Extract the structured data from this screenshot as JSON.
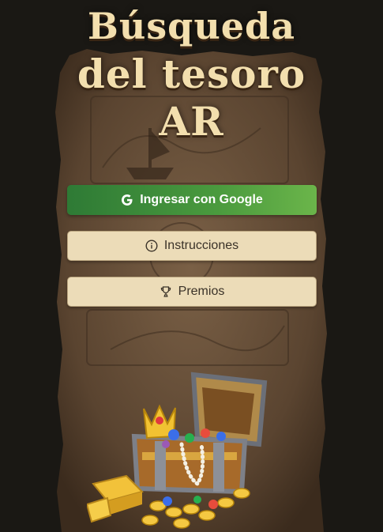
{
  "app": {
    "title_line1": "Búsqueda",
    "title_line2": "del tesoro",
    "title_line3": "AR"
  },
  "buttons": {
    "google_label": "Ingresar con Google",
    "instructions_label": "Instrucciones",
    "prizes_label": "Premios"
  },
  "icons": {
    "google": "google-icon",
    "instructions": "info-icon",
    "prizes": "trophy-icon"
  },
  "colors": {
    "title": "#f3dfae",
    "google_button_start": "#2e7a35",
    "google_button_end": "#6bb54a",
    "light_button": "#ecdcb8",
    "background": "#1a1814",
    "parchment": "#5e4733"
  }
}
